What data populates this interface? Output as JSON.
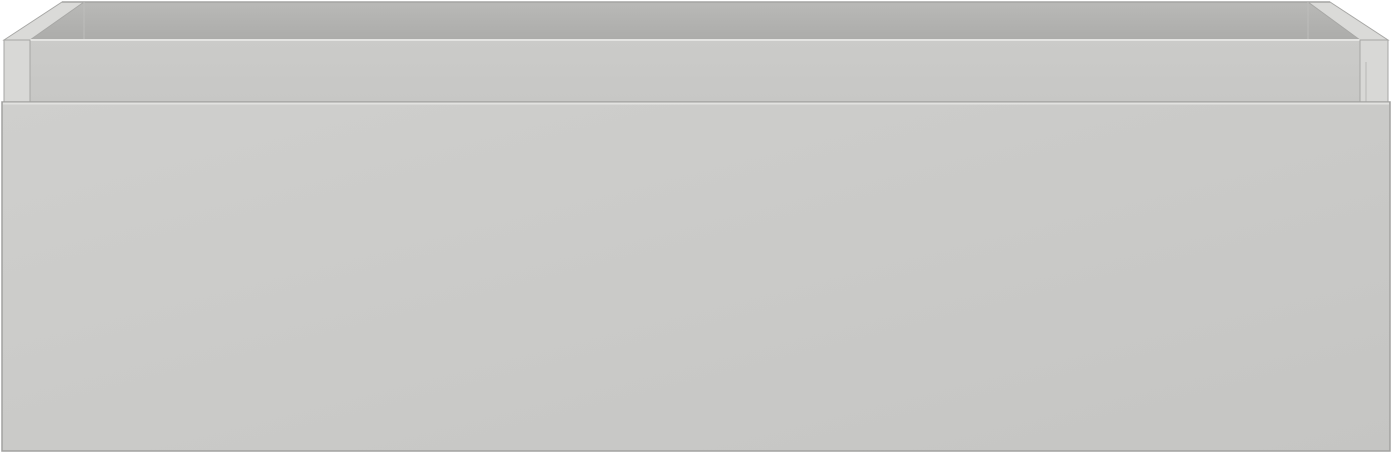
{
  "object": {
    "kind": "open drawer box",
    "colors": {
      "background": "#ffffff",
      "front_panel_light": "#cdcdcb",
      "front_panel_dark": "#c6c6c4",
      "inner_back_wall": "#b3b3b1",
      "inner_side_wall": "#c4c4c2",
      "rim": "#d9d9d7",
      "inner_ledge": "#cacac8",
      "edge_line": "#9e9e9c",
      "highlight": "#e6e6e4"
    }
  }
}
